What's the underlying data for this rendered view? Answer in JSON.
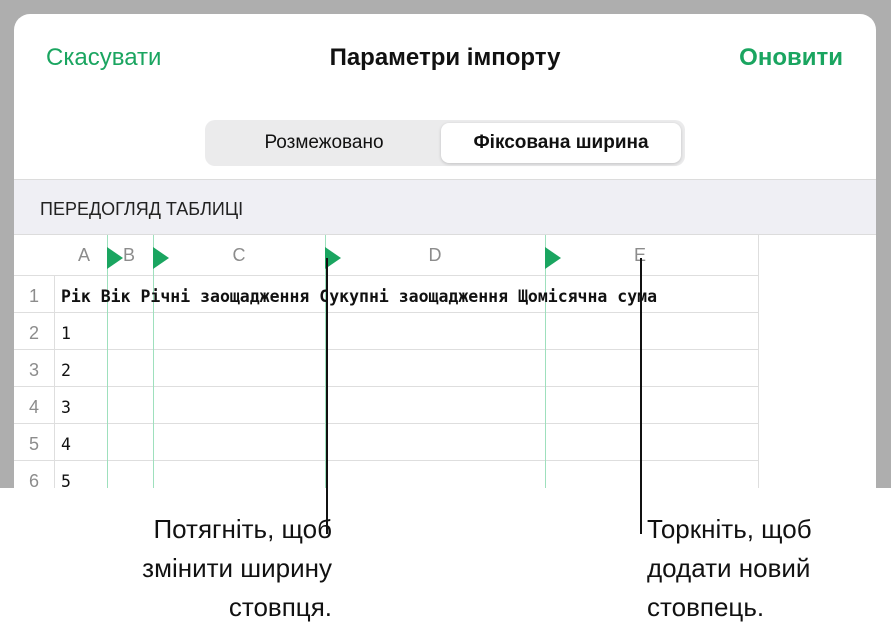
{
  "nav": {
    "cancel_label": "Скасувати",
    "title": "Параметри імпорту",
    "update_label": "Оновити"
  },
  "segmented": {
    "options": [
      "Розмежовано",
      "Фіксована ширина"
    ],
    "selected": "Фіксована ширина"
  },
  "section_title": "ПЕРЕДОГЛЯД ТАБЛИЦІ",
  "columns": [
    "A",
    "B",
    "C",
    "D",
    "E"
  ],
  "rows": [
    "1",
    "2",
    "3",
    "4",
    "5",
    "6"
  ],
  "header_line": "Рік Вік Річні заощадження Сукупні заощадження Щомісячна сума",
  "data_values": [
    "1",
    "2",
    "3",
    "4",
    "5"
  ],
  "callouts": {
    "drag": [
      "Потягніть, щоб",
      "змінити ширину",
      "стовпця."
    ],
    "tap": [
      "Торкніть, щоб",
      "додати новий",
      "стовпець."
    ]
  },
  "colors": {
    "accent": "#1aa560",
    "divider": "#9ee0bd",
    "backdrop": "#aeaeae"
  }
}
